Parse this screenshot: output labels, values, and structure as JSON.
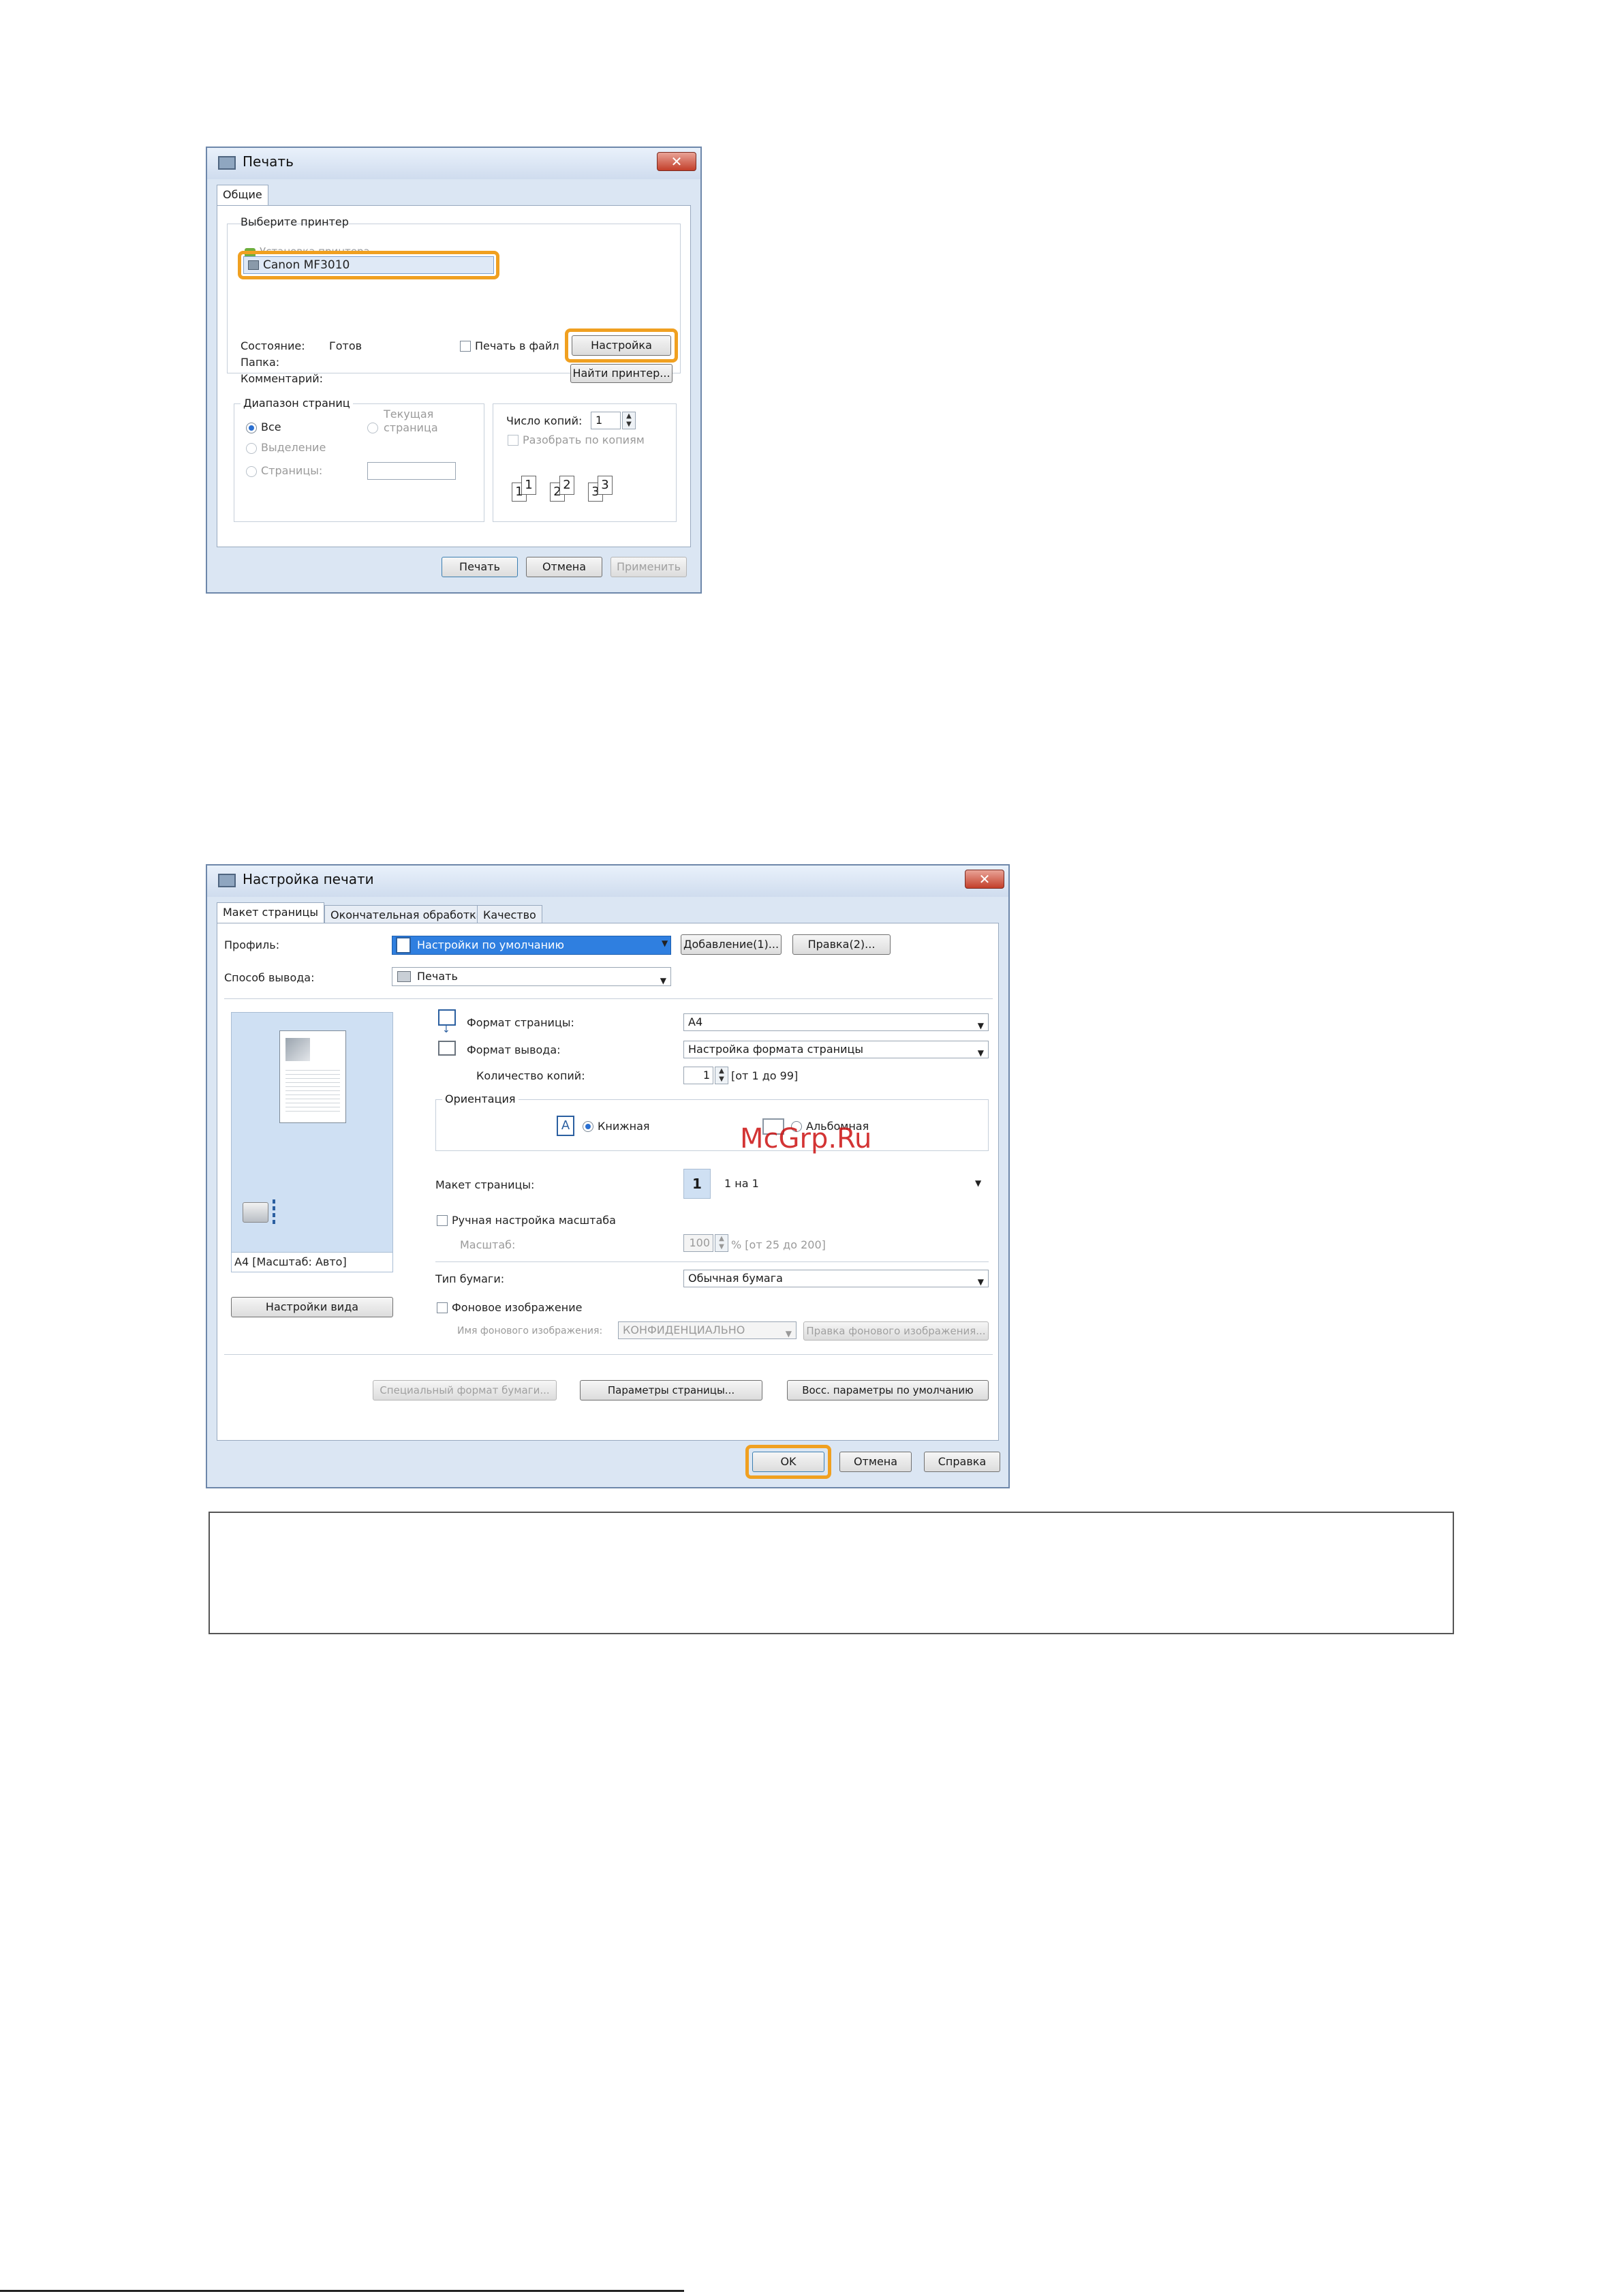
{
  "print_dialog": {
    "title": "Печать",
    "tab_general": "Общие",
    "select_printer_label": "Выберите принтер",
    "add_printer_item": "Установка принтера",
    "selected_printer": "Canon MF3010",
    "status_label": "Состояние:",
    "status_value": "Готов",
    "folder_label": "Папка:",
    "comment_label": "Комментарий:",
    "print_to_file_label": "Печать в файл",
    "settings_button": "Настройка",
    "find_printer_button": "Найти принтер...",
    "page_range_title": "Диапазон страниц",
    "range_all": "Все",
    "range_current_line1": "Текущая",
    "range_current_line2": "страница",
    "range_selection": "Выделение",
    "range_pages": "Страницы:",
    "copies_label": "Число копий:",
    "copies_value": "1",
    "collate_label": "Разобрать по копиям",
    "print_button": "Печать",
    "cancel_button": "Отмена",
    "apply_button": "Применить"
  },
  "print_settings": {
    "title": "Настройка печати",
    "tabs": [
      "Макет страницы",
      "Окончательная обработка",
      "Качество"
    ],
    "profile_label": "Профиль:",
    "profile_value": "Настройки по умолчанию",
    "add_button": "Добавление(1)...",
    "edit_button": "Правка(2)...",
    "output_method_label": "Способ вывода:",
    "output_method_value": "Печать",
    "preview_caption": "A4 [Масштаб: Авто]",
    "view_settings_button": "Настройки вида",
    "page_size_label": "Формат страницы:",
    "page_size_value": "A4",
    "output_size_label": "Формат вывода:",
    "output_size_value": "Настройка формата страницы",
    "copies_label": "Количество копий:",
    "copies_value": "1",
    "copies_range": "[от 1 до 99]",
    "orientation_title": "Ориентация",
    "orientation_portrait": "Книжная",
    "orientation_landscape": "Альбомная",
    "page_layout_label": "Макет страницы:",
    "page_layout_value": "1 на 1",
    "page_layout_icon_num": "1",
    "manual_scaling_label": "Ручная настройка масштаба",
    "scaling_label": "Масштаб:",
    "scaling_value": "100",
    "scaling_range": "% [от 25 до 200]",
    "paper_type_label": "Тип бумаги:",
    "paper_type_value": "Обычная бумага",
    "watermark_label": "Фоновое изображение",
    "watermark_name_label": "Имя фонового изображения:",
    "watermark_name_value": "КОНФИДЕНЦИАЛЬНО",
    "watermark_edit_button": "Правка фонового изображения...",
    "custom_paper_button": "Специальный формат бумаги...",
    "page_options_button": "Параметры страницы...",
    "restore_defaults_button": "Восс. параметры по умолчанию",
    "ok_button": "OK",
    "cancel_button": "Отмена",
    "help_button": "Справка"
  },
  "watermark_overlay": "McGrp.Ru",
  "colors": {
    "highlight": "#f0a020",
    "selection": "#2f7fe0",
    "watermark": "#cc1111"
  }
}
